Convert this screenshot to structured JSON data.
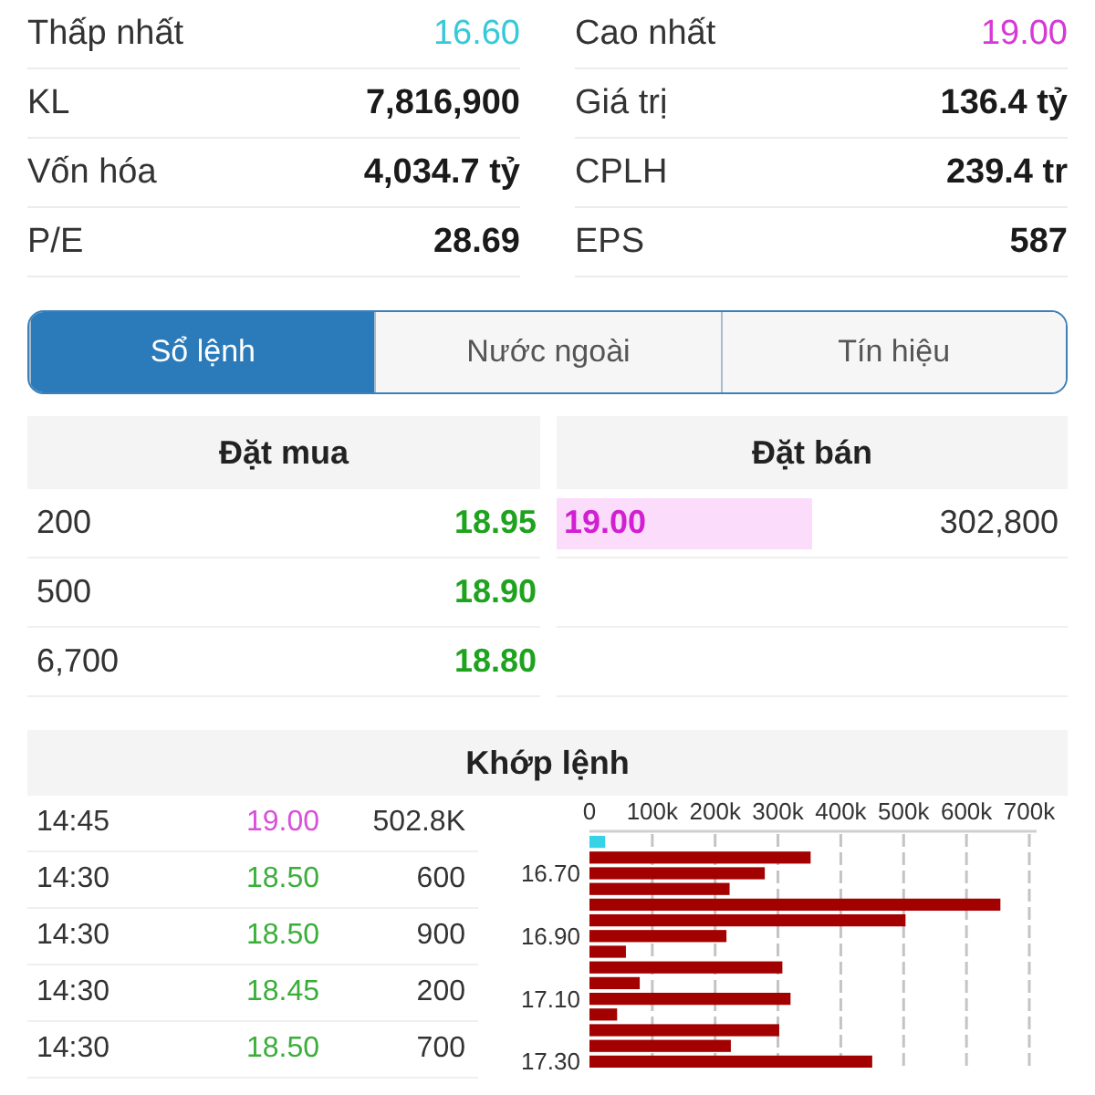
{
  "stats": [
    {
      "label": "Thấp nhất",
      "value": "16.60",
      "kind": "price",
      "color": "#35c9d9"
    },
    {
      "label": "Cao nhất",
      "value": "19.00",
      "kind": "price",
      "color": "#d63ad6"
    },
    {
      "label": "KL",
      "value": "7,816,900",
      "kind": "figure"
    },
    {
      "label": "Giá trị",
      "value": "136.4 tỷ",
      "kind": "figure"
    },
    {
      "label": "Vốn hóa",
      "value": "4,034.7 tỷ",
      "kind": "figure"
    },
    {
      "label": "CPLH",
      "value": "239.4 tr",
      "kind": "figure"
    },
    {
      "label": "P/E",
      "value": "28.69",
      "kind": "figure"
    },
    {
      "label": "EPS",
      "value": "587",
      "kind": "figure"
    }
  ],
  "tabs": [
    {
      "label": "Sổ lệnh",
      "selected": true
    },
    {
      "label": "Nước ngoài",
      "selected": false
    },
    {
      "label": "Tín hiệu",
      "selected": false
    }
  ],
  "order_book": {
    "buy": {
      "title": "Đặt mua",
      "rows": [
        {
          "volume": "200",
          "price": "18.95",
          "color": "#1fa31f",
          "highlighted": false
        },
        {
          "volume": "500",
          "price": "18.90",
          "color": "#1fa31f",
          "highlighted": false
        },
        {
          "volume": "6,700",
          "price": "18.80",
          "color": "#1fa31f",
          "highlighted": false
        }
      ]
    },
    "sell": {
      "title": "Đặt bán",
      "rows": [
        {
          "price": "19.00",
          "volume": "302,800",
          "color": "#d21fd2",
          "highlighted": true
        }
      ]
    }
  },
  "matches": {
    "title": "Khớp lệnh",
    "trades": [
      {
        "time": "14:45",
        "price": "19.00",
        "volume": "502.8K",
        "color": "#d94fd9"
      },
      {
        "time": "14:30",
        "price": "18.50",
        "volume": "600",
        "color": "#3aae3a"
      },
      {
        "time": "14:30",
        "price": "18.50",
        "volume": "900",
        "color": "#3aae3a"
      },
      {
        "time": "14:30",
        "price": "18.45",
        "volume": "200",
        "color": "#3aae3a"
      },
      {
        "time": "14:30",
        "price": "18.50",
        "volume": "700",
        "color": "#3aae3a"
      }
    ],
    "chart_data": {
      "type": "bar",
      "orientation": "horizontal",
      "grid": true,
      "x": [
        16.6,
        16.65,
        16.7,
        16.75,
        16.8,
        16.85,
        16.9,
        16.95,
        17.0,
        17.05,
        17.1,
        17.15,
        17.2,
        17.25,
        17.3
      ],
      "ylim": [
        17.325,
        16.575
      ],
      "yticks": [
        {
          "value": 16.7,
          "label": "16.70"
        },
        {
          "value": 16.9,
          "label": "16.90"
        },
        {
          "value": 17.1,
          "label": "17.10"
        },
        {
          "value": 17.3,
          "label": "17.30"
        }
      ],
      "xlim": [
        0,
        700000
      ],
      "xticks": [
        {
          "value": 0,
          "label": "0"
        },
        {
          "value": 100000,
          "label": "100k"
        },
        {
          "value": 200000,
          "label": "200k"
        },
        {
          "value": 300000,
          "label": "300k"
        },
        {
          "value": 400000,
          "label": "400k"
        },
        {
          "value": 500000,
          "label": "500k"
        },
        {
          "value": 600000,
          "label": "600k"
        },
        {
          "value": 700000,
          "label": "700k"
        }
      ],
      "series": [
        {
          "color": "#36d3e6",
          "values": [
            25000,
            null,
            null,
            null,
            null,
            null,
            null,
            null,
            null,
            null,
            null,
            null,
            null,
            null,
            null
          ]
        },
        {
          "color": "#a30000",
          "values": [
            null,
            352000,
            279000,
            223000,
            654000,
            503000,
            218000,
            58000,
            307000,
            80000,
            320000,
            44000,
            302000,
            225000,
            450000
          ]
        }
      ]
    }
  }
}
